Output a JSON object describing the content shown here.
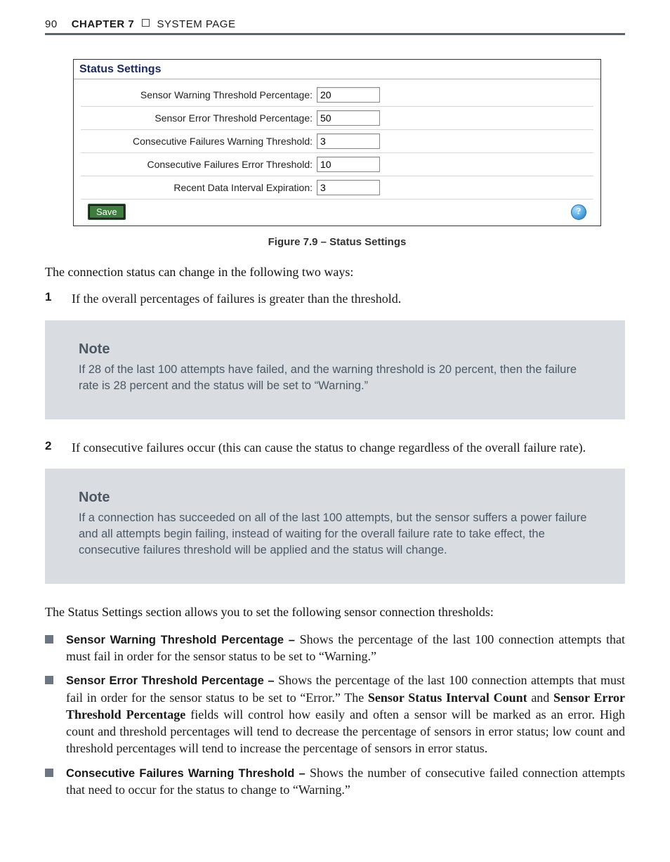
{
  "header": {
    "page_number": "90",
    "chapter_label": "CHAPTER 7",
    "section_title": "SYSTEM PAGE"
  },
  "figure": {
    "panel_title": "Status Settings",
    "settings": [
      {
        "label": "Sensor Warning Threshold Percentage:",
        "value": "20"
      },
      {
        "label": "Sensor Error Threshold Percentage:",
        "value": "50"
      },
      {
        "label": "Consecutive Failures Warning Threshold:",
        "value": "3"
      },
      {
        "label": "Consecutive Failures Error Threshold:",
        "value": "10"
      },
      {
        "label": "Recent Data Interval Expiration:",
        "value": "3"
      }
    ],
    "save_label": "Save",
    "help_glyph": "?",
    "caption": "Figure 7.9 – Status Settings"
  },
  "body": {
    "intro": "The connection status can change in the following two ways:",
    "list": [
      {
        "num": "1",
        "text": "If the overall percentages of failures is greater than the threshold."
      },
      {
        "num": "2",
        "text": "If consecutive failures occur (this can cause the status to change regardless of the overall failure rate)."
      }
    ],
    "notes": [
      {
        "heading": "Note",
        "body": "If 28 of the last 100 attempts have failed, and the warning threshold is 20 percent, then the failure rate is 28 percent and the status will be set to “Warning.”"
      },
      {
        "heading": "Note",
        "body": "If a connection has succeeded on all of the last 100 attempts, but the sensor suffers a power failure and all attempts begin failing, instead of waiting for the overall failure rate to take effect, the consecutive failures threshold will be applied and the status will change."
      }
    ],
    "thresholds_intro": "The Status Settings section allows you to set the following sensor connection thresholds:",
    "bullets": [
      {
        "lead": "Sensor Warning Threshold Percentage – ",
        "rest": "Shows the percentage of the last 100 connection attempts that must fail in order for the sensor status to be set to “Warning.”"
      },
      {
        "lead": "Sensor Error Threshold Percentage – ",
        "rest_a": "Shows the percentage of the last 100 connection attempts that must fail in order for the sensor status to be set to “Error.” The ",
        "bold1": "Sensor Status Interval Count",
        "mid": " and ",
        "bold2": "Sensor Error Threshold Percentage",
        "rest_b": " fields will control how easily and often a sensor will be marked as an error. High count and threshold percentages will tend to decrease the percentage of sensors in error status; low count and threshold percentages will tend to increase the percentage of sensors in error status."
      },
      {
        "lead": "Consecutive Failures Warning Threshold – ",
        "rest": "Shows the number of consecutive failed connection attempts that need to occur for the status to change to “Warning.”"
      }
    ]
  }
}
